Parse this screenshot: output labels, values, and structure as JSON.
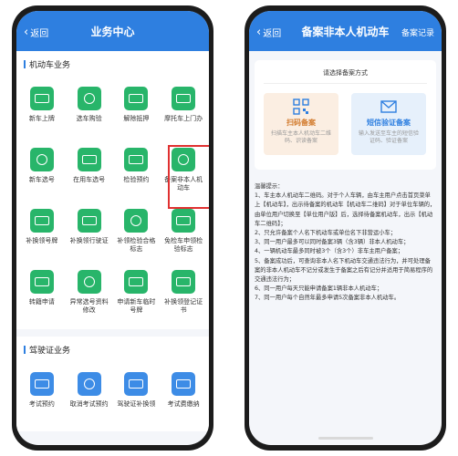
{
  "left": {
    "header": {
      "back_label": "返回",
      "title": "业务中心"
    },
    "vehicle_section": "机动车业务",
    "vehicle_items": [
      {
        "label": "新车上牌",
        "icon": "car-plate-icon"
      },
      {
        "label": "选车购验",
        "icon": "car-icon"
      },
      {
        "label": "解除抵押",
        "icon": "document-icon"
      },
      {
        "label": "摩托车上门办",
        "icon": "car-plate-icon"
      },
      {
        "label": "新车选号",
        "icon": "car-plate-icon"
      },
      {
        "label": "在用车选号",
        "icon": "car-plate-icon"
      },
      {
        "label": "检验预约",
        "icon": "inspection-icon"
      },
      {
        "label": "备案非本人机动车",
        "icon": "record-icon"
      },
      {
        "label": "补换领号牌",
        "icon": "plate-icon"
      },
      {
        "label": "补换领行驶证",
        "icon": "license-icon"
      },
      {
        "label": "补领检验合格标志",
        "icon": "badge-icon"
      },
      {
        "label": "免检车申领检验标志",
        "icon": "badge-icon"
      },
      {
        "label": "转籍申请",
        "icon": "transfer-icon"
      },
      {
        "label": "异常选号资料修改",
        "icon": "edit-icon"
      },
      {
        "label": "申请新车临时号牌",
        "icon": "car-plate-icon"
      },
      {
        "label": "补换领登记证书",
        "icon": "certificate-icon"
      }
    ],
    "driver_section": "驾驶证业务",
    "driver_items": [
      {
        "label": "考试预约",
        "icon": "calendar-icon"
      },
      {
        "label": "取消考试预约",
        "icon": "calendar-icon"
      },
      {
        "label": "驾驶证补换领",
        "icon": "id-card-icon"
      },
      {
        "label": "考试费缴纳",
        "icon": "payment-icon"
      }
    ]
  },
  "right": {
    "header": {
      "back_label": "返回",
      "title": "备案非本人机动车",
      "action": "备案记录"
    },
    "choose_title": "请选择备案方式",
    "options": [
      {
        "name": "扫码备案",
        "desc": "扫描车主本人机动车二维码、识读备案"
      },
      {
        "name": "短信验证备案",
        "desc": "输入发送至车主的短信验证码、验证备案"
      }
    ],
    "tips": [
      "温馨提示：",
      "1、车主本人机动车二维码。对于个人车辆，由车主用户点击首页菜单上【机动车】，出示待备案的机动车【机动车二维码】对于单位车辆的，由单位用户切换至【单位用户版】后，选择待备案机动车，出示【机动车二维码】；",
      "2、只允许备案个人名下机动车或单位名下非营运小车；",
      "3、同一用户最多可以同时备案3辆（含3辆）非本人机动车；",
      "4、一辆机动车最多同时被3个（含3个）非车主用户备案；",
      "5、备案成功后，可查询非本人名下机动车交通违法行为，并可处理备案的非本人机动车不记分或发生于备案之后有记分并适用于简易程序的交通违法行为；",
      "6、同一用户每天只能申请备案1辆非本人机动车；",
      "7、同一用户每个自然年最多申请5次备案非本人机动车。"
    ]
  }
}
